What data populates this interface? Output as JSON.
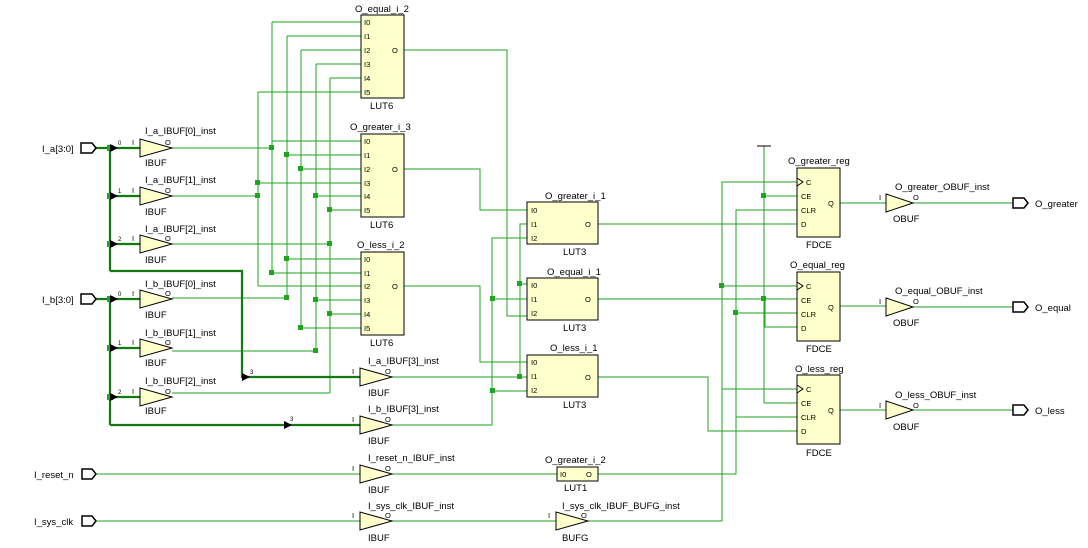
{
  "ports_in": {
    "a": "I_a[3:0]",
    "b": "I_b[3:0]",
    "reset": "I_reset_n",
    "clk": "I_sys_clk"
  },
  "ports_out": {
    "greater": "O_greater",
    "equal": "O_equal",
    "less": "O_less"
  },
  "buffers": {
    "a0": {
      "name": "I_a_IBUF[0]_inst",
      "type": "IBUF",
      "i": "I",
      "o": "O"
    },
    "a1": {
      "name": "I_a_IBUF[1]_inst",
      "type": "IBUF",
      "i": "I",
      "o": "O"
    },
    "a2": {
      "name": "I_a_IBUF[2]_inst",
      "type": "IBUF",
      "i": "I",
      "o": "O"
    },
    "b0": {
      "name": "I_b_IBUF[0]_inst",
      "type": "IBUF",
      "i": "I",
      "o": "O"
    },
    "b1": {
      "name": "I_b_IBUF[1]_inst",
      "type": "IBUF",
      "i": "I",
      "o": "O"
    },
    "b2": {
      "name": "I_b_IBUF[2]_inst",
      "type": "IBUF",
      "i": "I",
      "o": "O"
    },
    "a3": {
      "name": "I_a_IBUF[3]_inst",
      "type": "IBUF",
      "i": "I",
      "o": "O"
    },
    "b3": {
      "name": "I_b_IBUF[3]_inst",
      "type": "IBUF",
      "i": "I",
      "o": "O"
    },
    "rst": {
      "name": "I_reset_n_IBUF_inst",
      "type": "IBUF",
      "i": "I",
      "o": "O"
    },
    "clk": {
      "name": "I_sys_clk_IBUF_inst",
      "type": "IBUF",
      "i": "I",
      "o": "O"
    },
    "bufg": {
      "name": "I_sys_clk_IBUF_BUFG_inst",
      "type": "BUFG",
      "i": "I",
      "o": "O"
    },
    "ogt": {
      "name": "O_greater_OBUF_inst",
      "type": "OBUF",
      "i": "I",
      "o": "O"
    },
    "oeq": {
      "name": "O_equal_OBUF_inst",
      "type": "OBUF",
      "i": "I",
      "o": "O"
    },
    "olt": {
      "name": "O_less_OBUF_inst",
      "type": "OBUF",
      "i": "I",
      "o": "O"
    }
  },
  "bit_labels": {
    "b0": "0",
    "b1": "1",
    "b2": "2",
    "b3": "3"
  },
  "luts": {
    "eq2": {
      "name": "O_equal_i_2",
      "type": "LUT6",
      "out": "O",
      "pins": [
        "I0",
        "I1",
        "I2",
        "I3",
        "I4",
        "I5"
      ]
    },
    "gt3": {
      "name": "O_greater_i_3",
      "type": "LUT6",
      "out": "O",
      "pins": [
        "I0",
        "I1",
        "I2",
        "I3",
        "I4",
        "I5"
      ]
    },
    "lt2": {
      "name": "O_less_i_2",
      "type": "LUT6",
      "out": "O",
      "pins": [
        "I0",
        "I1",
        "I2",
        "I3",
        "I4",
        "I5"
      ]
    },
    "gt1": {
      "name": "O_greater_i_1",
      "type": "LUT3",
      "out": "O",
      "pins": [
        "I0",
        "I1",
        "I2"
      ]
    },
    "eq1": {
      "name": "O_equal_i_1",
      "type": "LUT3",
      "out": "O",
      "pins": [
        "I0",
        "I1",
        "I2"
      ]
    },
    "lt1": {
      "name": "O_less_i_1",
      "type": "LUT3",
      "out": "O",
      "pins": [
        "I0",
        "I1",
        "I2"
      ]
    },
    "gt2": {
      "name": "O_greater_i_2",
      "type": "LUT1",
      "out": "O",
      "pins": [
        "I0"
      ]
    }
  },
  "regs": {
    "gt": {
      "name": "O_greater_reg",
      "type": "FDCE",
      "pins": [
        "C",
        "CE",
        "CLR",
        "D"
      ],
      "q": "Q"
    },
    "eq": {
      "name": "O_equal_reg",
      "type": "FDCE",
      "pins": [
        "C",
        "CE",
        "CLR",
        "D"
      ],
      "q": "Q"
    },
    "lt": {
      "name": "O_less_reg",
      "type": "FDCE",
      "pins": [
        "C",
        "CE",
        "CLR",
        "D"
      ],
      "q": "Q"
    }
  },
  "colors": {
    "wire": "#1fa51f",
    "bus": "#117a11",
    "cell_fill": "#ffffcc"
  }
}
